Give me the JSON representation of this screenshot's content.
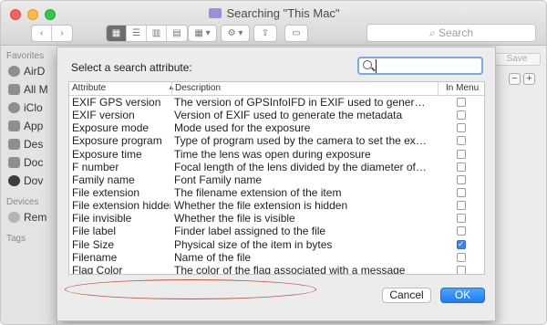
{
  "window": {
    "title": "Searching \"This Mac\""
  },
  "toolbar": {
    "back_label": "‹",
    "forward_label": "›",
    "search_placeholder": "Search",
    "save_label": "Save",
    "add_label": "+",
    "remove_label": "−"
  },
  "sidebar": {
    "favorites_heading": "Favorites",
    "favorites": [
      "AirD",
      "All M",
      "iClo",
      "App",
      "Des",
      "Doc",
      "Dov"
    ],
    "devices_heading": "Devices",
    "devices": [
      "Rem"
    ],
    "tags_heading": "Tags"
  },
  "dialog": {
    "prompt": "Select a search attribute:",
    "search_value": "",
    "columns": {
      "attribute": "Attribute",
      "description": "Description",
      "in_menu": "In Menu"
    },
    "rows": [
      {
        "attribute": "EXIF GPS version",
        "description": "The version of GPSInfoIFD in EXIF used to generate the me...",
        "in_menu": false
      },
      {
        "attribute": "EXIF version",
        "description": "Version of EXIF used to generate the metadata",
        "in_menu": false
      },
      {
        "attribute": "Exposure mode",
        "description": "Mode used for the exposure",
        "in_menu": false
      },
      {
        "attribute": "Exposure program",
        "description": "Type of program used by the camera to set the exposure:...",
        "in_menu": false
      },
      {
        "attribute": "Exposure time",
        "description": "Time the lens was open during exposure",
        "in_menu": false
      },
      {
        "attribute": "F number",
        "description": "Focal length of the lens divided by the diameter of the aper...",
        "in_menu": false
      },
      {
        "attribute": "Family name",
        "description": "Font Family name",
        "in_menu": false
      },
      {
        "attribute": "File extension",
        "description": "The filename extension of the item",
        "in_menu": false
      },
      {
        "attribute": "File extension hidden",
        "description": "Whether the file extension is hidden",
        "in_menu": false
      },
      {
        "attribute": "File invisible",
        "description": "Whether the file is visible",
        "in_menu": false
      },
      {
        "attribute": "File label",
        "description": "Finder label assigned to the file",
        "in_menu": false
      },
      {
        "attribute": "File Size",
        "description": "Physical size of the item in bytes",
        "in_menu": true
      },
      {
        "attribute": "Filename",
        "description": "Name of the file",
        "in_menu": false
      },
      {
        "attribute": "Flag Color",
        "description": "The color of the flag associated with a message",
        "in_menu": false
      }
    ],
    "cancel_label": "Cancel",
    "ok_label": "OK"
  },
  "colors": {
    "accent": "#1a7cf6",
    "highlight_oval": "#c8533a"
  }
}
